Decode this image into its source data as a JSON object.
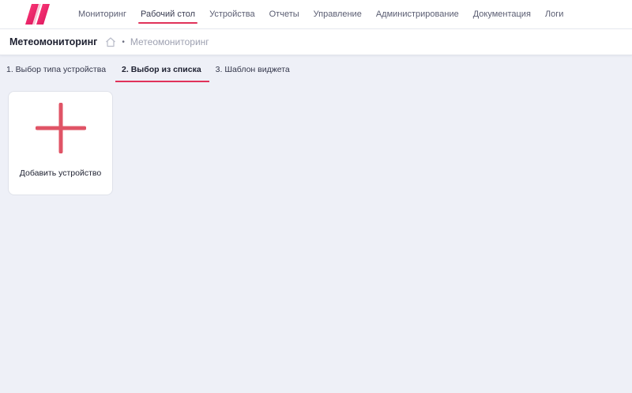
{
  "nav": {
    "items": [
      {
        "label": "Мониторинг",
        "active": false
      },
      {
        "label": "Рабочий стол",
        "active": true
      },
      {
        "label": "Устройства",
        "active": false
      },
      {
        "label": "Отчеты",
        "active": false
      },
      {
        "label": "Управление",
        "active": false
      },
      {
        "label": "Администрирование",
        "active": false
      },
      {
        "label": "Документация",
        "active": false
      },
      {
        "label": "Логи",
        "active": false
      }
    ]
  },
  "header": {
    "title": "Метеомониторинг",
    "separator": "•",
    "breadcrumb_current": "Метеомониторинг"
  },
  "tabs": [
    {
      "label": "1. Выбор типа устройства",
      "active": false
    },
    {
      "label": "2. Выбор из списка",
      "active": true
    },
    {
      "label": "3. Шаблон виджета",
      "active": false
    }
  ],
  "card": {
    "label": "Добавить устройство",
    "icon": "plus-icon"
  },
  "colors": {
    "accent": "#e0325a",
    "plus": "#e05466",
    "background": "#eef0f7"
  }
}
